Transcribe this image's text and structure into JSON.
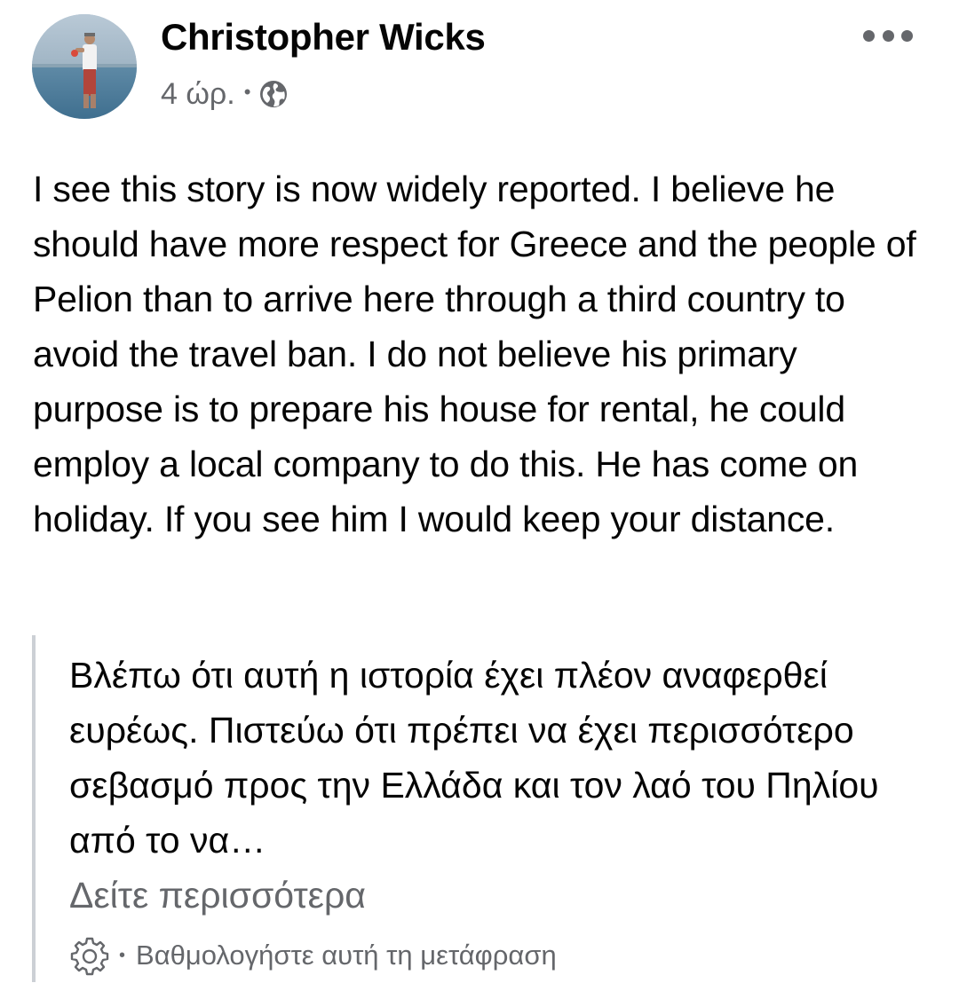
{
  "post": {
    "author": "Christopher Wicks",
    "time": "4 ώρ.",
    "separator": "•",
    "audience_icon": "globe-icon",
    "more_icon": "more-horizontal-icon",
    "body": "I see this story is now widely reported. I believe he should have more respect for Greece and the people of Pelion than to arrive here through a third country to avoid the travel ban. I do not believe his primary purpose is to prepare his house for rental, he could employ a local company to do this. He has come on holiday. If you see him I would keep your distance."
  },
  "translation": {
    "text": "Βλέπω ότι αυτή η ιστορία έχει πλέον αναφερθεί ευρέως. Πιστεύω ότι πρέπει να έχει περισσότερο σεβασμό προς την Ελλάδα και τον λαό του Πηλίου από το να…",
    "see_more": "Δείτε περισσότερα",
    "settings_icon": "gear-icon",
    "separator": "•",
    "rate_label": "Βαθμολογήστε αυτή τη μετάφραση"
  },
  "colors": {
    "primary_text": "#050505",
    "secondary_text": "#65676b",
    "quote_border": "#ccd0d5"
  }
}
